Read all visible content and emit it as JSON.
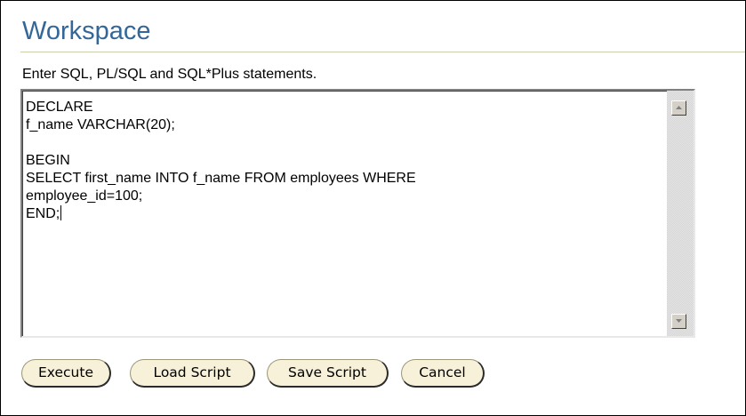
{
  "workspace": {
    "title": "Workspace",
    "instructions": "Enter SQL, PL/SQL and SQL*Plus statements."
  },
  "editor": {
    "code": "DECLARE\nf_name VARCHAR(20);\n\nBEGIN\nSELECT first_name INTO f_name FROM employees WHERE\nemployee_id=100;\nEND;"
  },
  "buttons": {
    "execute": "Execute",
    "load_script": "Load Script",
    "save_script": "Save Script",
    "cancel": "Cancel"
  },
  "colors": {
    "title": "#336699",
    "button_fill": "#f6f1d8",
    "rule": "#c9cfa8"
  },
  "icons": {
    "scroll_up": "scroll-up-arrow-icon",
    "scroll_down": "scroll-down-arrow-icon"
  }
}
